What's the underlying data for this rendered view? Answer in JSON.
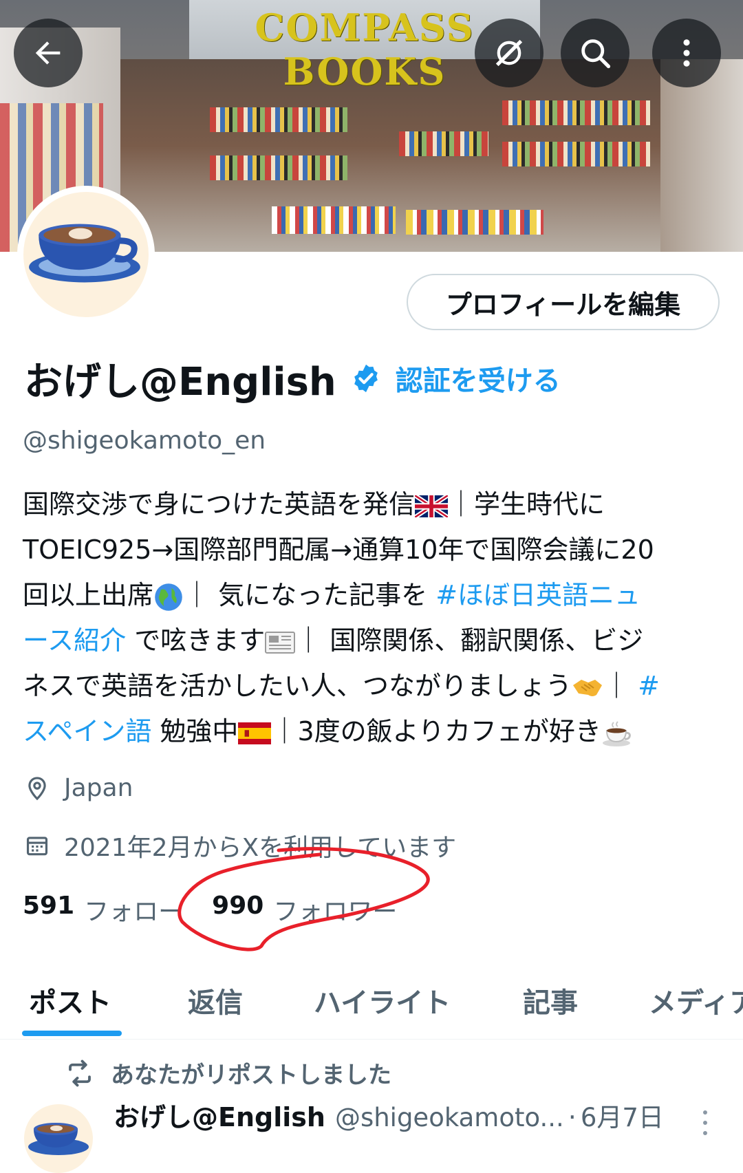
{
  "banner": {
    "store_sign": "COMPASS BOOKS"
  },
  "top_bar": {
    "back_icon": "arrow-left-icon",
    "grok_icon": "slash-circle-icon",
    "search_icon": "search-icon",
    "more_icon": "vertical-dots-icon"
  },
  "profile": {
    "edit_button": "プロフィールを編集",
    "display_name": "おげし@English",
    "verify_link": "認証を受ける",
    "handle": "@shigeokamoto_en",
    "bio": {
      "l1a": "国際交渉で身につけた英語を発信",
      "l1b": "｜学生時代に",
      "l2": "TOEIC925→国際部門配属→通算10年で国際会議に20",
      "l3a": "回以上出席",
      "l3b": "｜ 気になった記事を ",
      "l3tag": "#ほぼ日英語ニュ",
      "l4tag": "ース紹介",
      "l4a": " で呟きます",
      "l4b": "｜ 国際関係、翻訳関係、ビジ",
      "l5a": "ネスで英語を活かしたい人、つながりましょう",
      "l5b": "｜ ",
      "l5tag": "#",
      "l6tag": "スペイン語",
      "l6a": " 勉強中",
      "l6b": "｜3度の飯よりカフェが好き"
    },
    "location": "Japan",
    "joined": "2021年2月からXを利用しています",
    "following_count": "591",
    "following_label": "フォロー",
    "followers_count": "990",
    "followers_label": "フォロワー",
    "accent_color": "#1d9bf0",
    "annotation_color": "#e8202a"
  },
  "tabs": [
    "ポスト",
    "返信",
    "ハイライト",
    "記事",
    "メディア"
  ],
  "active_tab": "ポスト",
  "feed": {
    "repost_label": "あなたがリポストしました",
    "post_name": "おげし@English",
    "post_handle": "@shigeokamoto...",
    "post_sep": "·",
    "post_date": "6月7日"
  }
}
